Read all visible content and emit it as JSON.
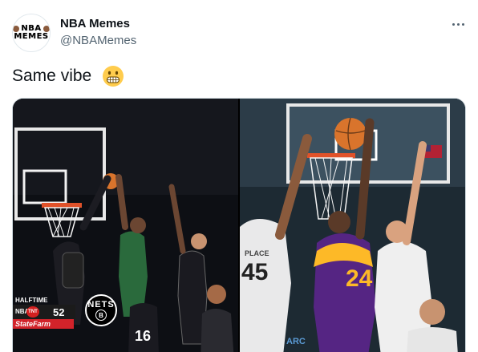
{
  "tweet": {
    "author_name": "NBA Memes",
    "author_handle": "@NBAMemes",
    "avatar_text_top": "NBA",
    "avatar_text_bottom": "MEMES",
    "text": "Same vibe",
    "emoji": "grimacing-face-emoji"
  },
  "media": {
    "left_panel": {
      "scoreboard": {
        "label": "HALFTIME",
        "league": "NBA",
        "network": "TNT",
        "score": "52",
        "sponsor": "StateFarm"
      },
      "team_logo_text": "NETS",
      "team_logo_letter": "B",
      "jersey_numbers": [
        "16"
      ]
    },
    "right_panel": {
      "jersey_numbers": [
        "45",
        "24"
      ],
      "jersey_names": [
        "PLACE"
      ],
      "court_text": "ARC"
    }
  },
  "colors": {
    "text_primary": "#0f1419",
    "text_secondary": "#536471",
    "lakers_gold": "#fdb927",
    "lakers_purple": "#552583"
  }
}
